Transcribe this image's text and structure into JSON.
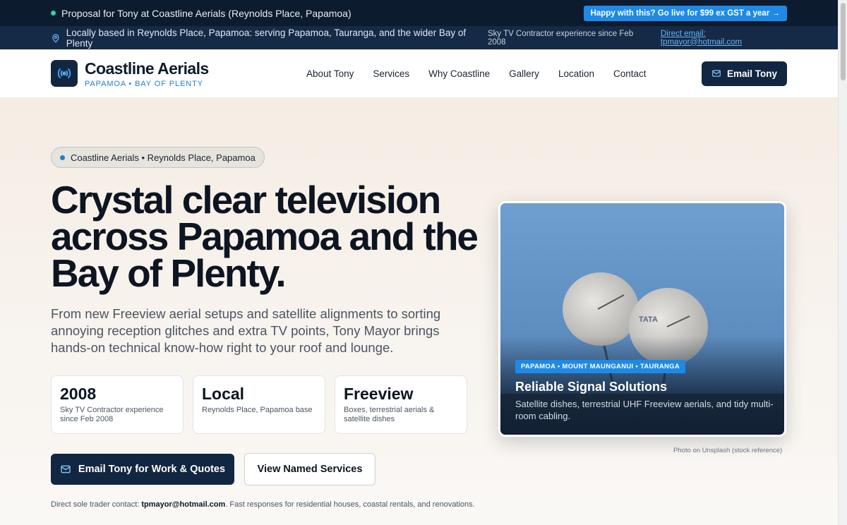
{
  "topbar": {
    "proposal_text": "Proposal for Tony at Coastline Aerials (Reynolds Place, Papamoa)",
    "cta_label": "Happy with this? Go live for $99 ex GST a year →"
  },
  "infobar": {
    "location_text": "Locally based in Reynolds Place, Papamoa: serving Papamoa, Tauranga, and the wider Bay of Plenty",
    "experience_text": "Sky TV Contractor experience since Feb 2008",
    "email_link": "Direct email: tpmayor@hotmail.com"
  },
  "brand": {
    "name": "Coastline Aerials",
    "tagline": "PAPAMOA • BAY OF PLENTY"
  },
  "nav": {
    "items": [
      "About Tony",
      "Services",
      "Why Coastline",
      "Gallery",
      "Location",
      "Contact"
    ],
    "email_button": "Email Tony"
  },
  "hero": {
    "badge": "Coastline Aerials • Reynolds Place, Papamoa",
    "headline": "Crystal clear television across Papamoa and the Bay of Plenty.",
    "lead": "From new Freeview aerial setups and satellite alignments to sorting annoying reception glitches and extra TV points, Tony Mayor brings hands-on technical know-how right to your roof and lounge.",
    "stats": [
      {
        "big": "2008",
        "small": "Sky TV Contractor experience since Feb 2008"
      },
      {
        "big": "Local",
        "small": "Reynolds Place, Papamoa base"
      },
      {
        "big": "Freeview",
        "small": "Boxes, terrestrial aerials & satellite dishes"
      }
    ],
    "primary_button": "Email Tony for Work & Quotes",
    "secondary_button": "View Named Services",
    "contact_note_prefix": "Direct sole trader contact: ",
    "contact_note_email": "tpmayor@hotmail.com",
    "contact_note_suffix": ". Fast responses for residential houses, coastal rentals, and renovations."
  },
  "photo": {
    "tag": "PAPAMOA • MOUNT MAUNGANUI • TAURANGA",
    "title": "Reliable Signal Solutions",
    "subtitle": "Satellite dishes, terrestrial UHF Freeview aerials, and tidy multi-room cabling.",
    "dish_text": "TATA",
    "credit": "Photo on Unsplash (stock reference)"
  },
  "colors": {
    "dark_navy": "#0c1b2e",
    "accent_blue": "#1e8ae6",
    "status_green": "#2dd4a0"
  },
  "icons": [
    "status-dot-icon",
    "map-pin-icon",
    "antenna-signal-icon",
    "mail-icon"
  ]
}
